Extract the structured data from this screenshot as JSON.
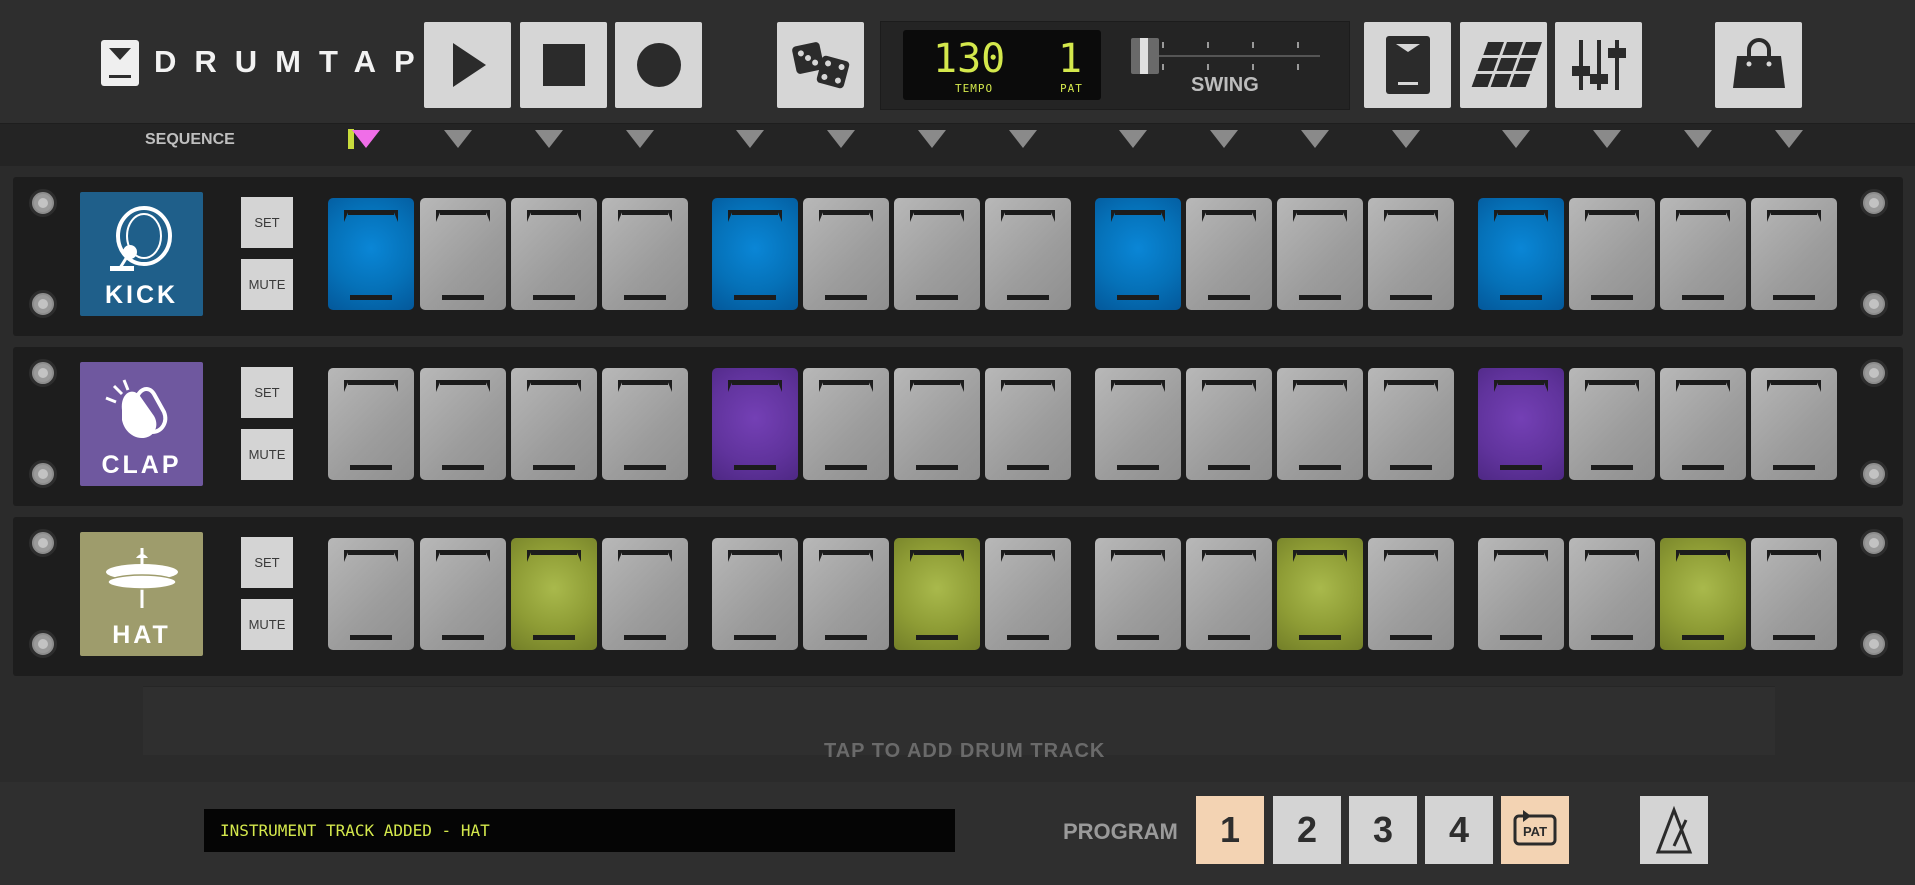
{
  "app": {
    "logo_text": "DRUMTAP"
  },
  "display": {
    "tempo_value": "130",
    "tempo_label": "TEMPO",
    "pattern_value": "1",
    "pattern_label": "PAT",
    "swing_label": "SWING"
  },
  "sequence": {
    "label": "SEQUENCE",
    "playhead_step": 1,
    "steps": 16
  },
  "tracks": [
    {
      "name": "KICK",
      "color": "#1f5f8a",
      "set_label": "SET",
      "mute_label": "MUTE",
      "active_color": "blue",
      "steps": [
        1,
        0,
        0,
        0,
        1,
        0,
        0,
        0,
        1,
        0,
        0,
        0,
        1,
        0,
        0,
        0
      ]
    },
    {
      "name": "CLAP",
      "color": "#6f589f",
      "set_label": "SET",
      "mute_label": "MUTE",
      "active_color": "purple",
      "steps": [
        0,
        0,
        0,
        0,
        1,
        0,
        0,
        0,
        0,
        0,
        0,
        0,
        1,
        0,
        0,
        0
      ]
    },
    {
      "name": "HAT",
      "color": "#9e9c6c",
      "set_label": "SET",
      "mute_label": "MUTE",
      "active_color": "green",
      "steps": [
        0,
        0,
        1,
        0,
        0,
        0,
        1,
        0,
        0,
        0,
        1,
        0,
        0,
        0,
        1,
        0
      ]
    }
  ],
  "add_track": {
    "label": "TAP TO ADD DRUM TRACK"
  },
  "status": {
    "message": "INSTRUMENT TRACK ADDED - HAT"
  },
  "program": {
    "label": "PROGRAM",
    "items": [
      "1",
      "2",
      "3",
      "4"
    ],
    "active": "1",
    "pat_label": "PAT"
  }
}
